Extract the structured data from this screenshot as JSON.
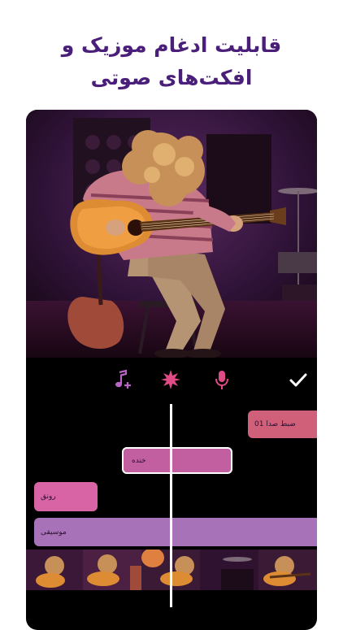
{
  "headline": {
    "line1": "قابلیت ادغام موزیک و",
    "line2": "افکت‌های صوتی"
  },
  "colors": {
    "headline": "#4a1f7a",
    "clip_record": "#d0607a",
    "clip_laugh": "#c25fa0",
    "clip_ambience": "#d864a6",
    "clip_music": "#a872b8",
    "icon_purple": "#b766c6",
    "icon_pink": "#e04b86"
  },
  "toolbar": {
    "add_music_icon": "music-note-plus-icon",
    "effects_icon": "sparkle-icon",
    "record_icon": "microphone-icon",
    "confirm_icon": "checkmark-icon"
  },
  "tracks": {
    "record": "ضبط صدا 01",
    "laugh": "خنده",
    "ambience": "رونق",
    "music": "موسیقی"
  }
}
